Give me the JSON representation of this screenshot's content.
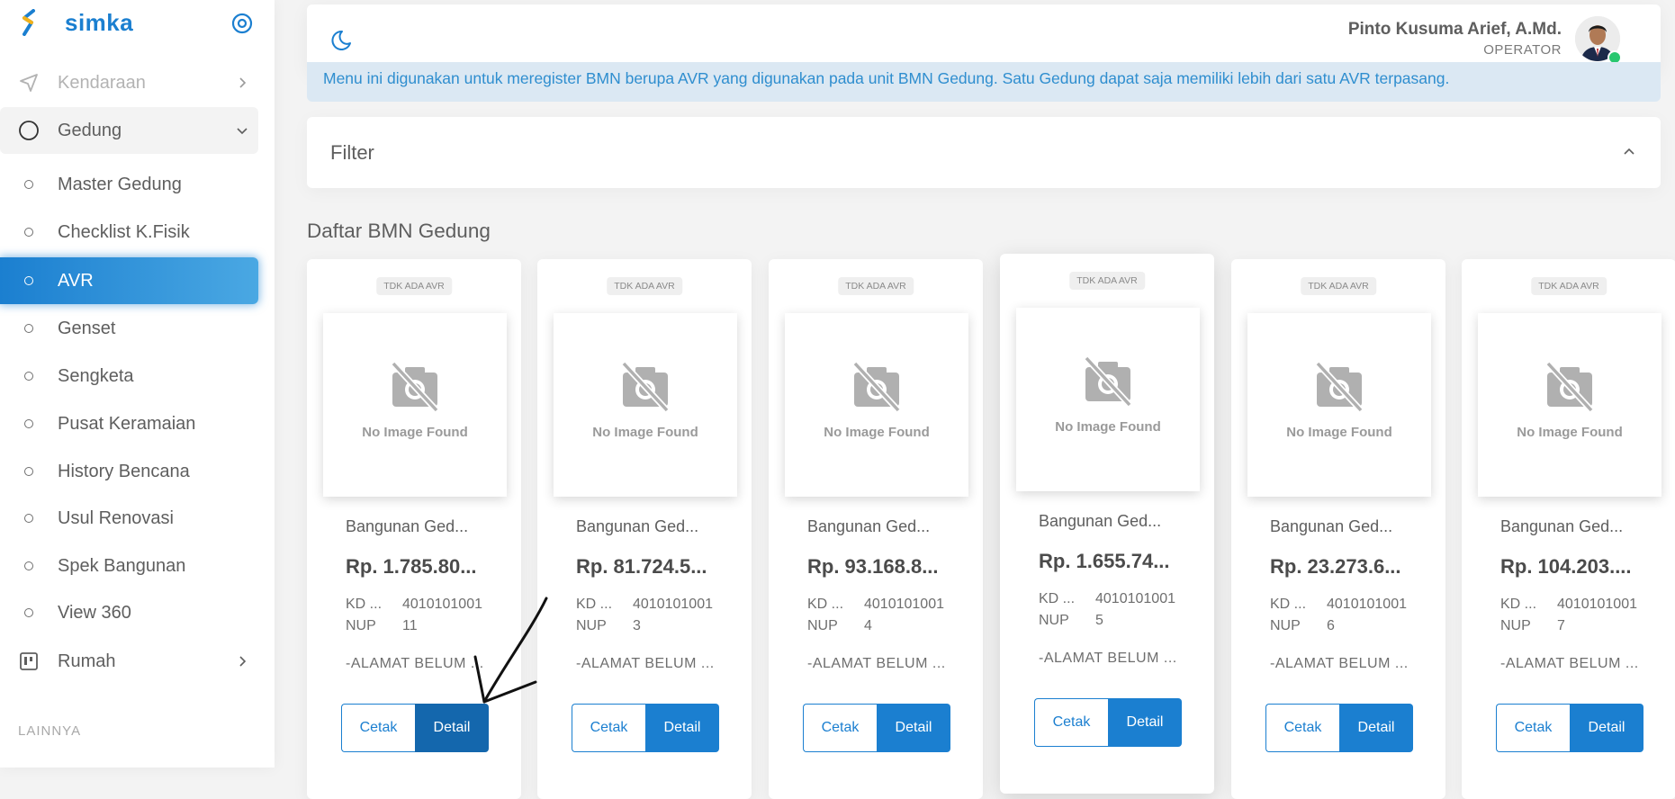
{
  "sidebar": {
    "brand": "simka",
    "nav": {
      "kendaraan": "Kendaraan",
      "gedung": "Gedung",
      "rumah": "Rumah"
    },
    "sub_items": [
      {
        "label": "Master Gedung"
      },
      {
        "label": "Checklist K.Fisik"
      },
      {
        "label": "AVR",
        "active": true
      },
      {
        "label": "Genset"
      },
      {
        "label": "Sengketa"
      },
      {
        "label": "Pusat Keramaian"
      },
      {
        "label": "History Bencana"
      },
      {
        "label": "Usul Renovasi"
      },
      {
        "label": "Spek Bangunan"
      },
      {
        "label": "View 360"
      }
    ],
    "section_label": "LAINNYA"
  },
  "header": {
    "user_name": "Pinto Kusuma Arief, A.Md.",
    "user_role": "OPERATOR"
  },
  "alert": {
    "text": "Menu ini digunakan untuk meregister BMN berupa AVR yang digunakan pada unit BMN Gedung. Satu Gedung dapat saja memiliki lebih dari satu AVR terpasang."
  },
  "filter": {
    "title": "Filter"
  },
  "list": {
    "title": "Daftar BMN Gedung",
    "cards": [
      {
        "badge": "TDK ADA AVR",
        "no_image": "No Image Found",
        "name": "Bangunan Ged...",
        "price": "Rp. 1.785.80...",
        "kd_label": "KD ...",
        "kd_value": "4010101001",
        "nup_label": "NUP",
        "nup_value": "11",
        "address": "-ALAMAT BELUM ...",
        "cetak": "Cetak",
        "detail": "Detail"
      },
      {
        "badge": "TDK ADA AVR",
        "no_image": "No Image Found",
        "name": "Bangunan Ged...",
        "price": "Rp. 81.724.5...",
        "kd_label": "KD ...",
        "kd_value": "4010101001",
        "nup_label": "NUP",
        "nup_value": "3",
        "address": "-ALAMAT BELUM ...",
        "cetak": "Cetak",
        "detail": "Detail"
      },
      {
        "badge": "TDK ADA AVR",
        "no_image": "No Image Found",
        "name": "Bangunan Ged...",
        "price": "Rp. 93.168.8...",
        "kd_label": "KD ...",
        "kd_value": "4010101001",
        "nup_label": "NUP",
        "nup_value": "4",
        "address": "-ALAMAT BELUM ...",
        "cetak": "Cetak",
        "detail": "Detail"
      },
      {
        "badge": "TDK ADA AVR",
        "no_image": "No Image Found",
        "name": "Bangunan Ged...",
        "price": "Rp. 1.655.74...",
        "kd_label": "KD ...",
        "kd_value": "4010101001",
        "nup_label": "NUP",
        "nup_value": "5",
        "address": "-ALAMAT BELUM ...",
        "cetak": "Cetak",
        "detail": "Detail"
      },
      {
        "badge": "TDK ADA AVR",
        "no_image": "No Image Found",
        "name": "Bangunan Ged...",
        "price": "Rp. 23.273.6...",
        "kd_label": "KD ...",
        "kd_value": "4010101001",
        "nup_label": "NUP",
        "nup_value": "6",
        "address": "-ALAMAT BELUM ...",
        "cetak": "Cetak",
        "detail": "Detail"
      },
      {
        "badge": "TDK ADA AVR",
        "no_image": "No Image Found",
        "name": "Bangunan Ged...",
        "price": "Rp. 104.203....",
        "kd_label": "KD ...",
        "kd_value": "4010101001",
        "nup_label": "NUP",
        "nup_value": "7",
        "address": "-ALAMAT BELUM ...",
        "cetak": "Cetak",
        "detail": "Detail"
      }
    ]
  },
  "colors": {
    "primary": "#1b7fd0",
    "alert_bg": "#dbe8f3",
    "alert_text": "#2f8ecf",
    "online": "#28c76f"
  }
}
